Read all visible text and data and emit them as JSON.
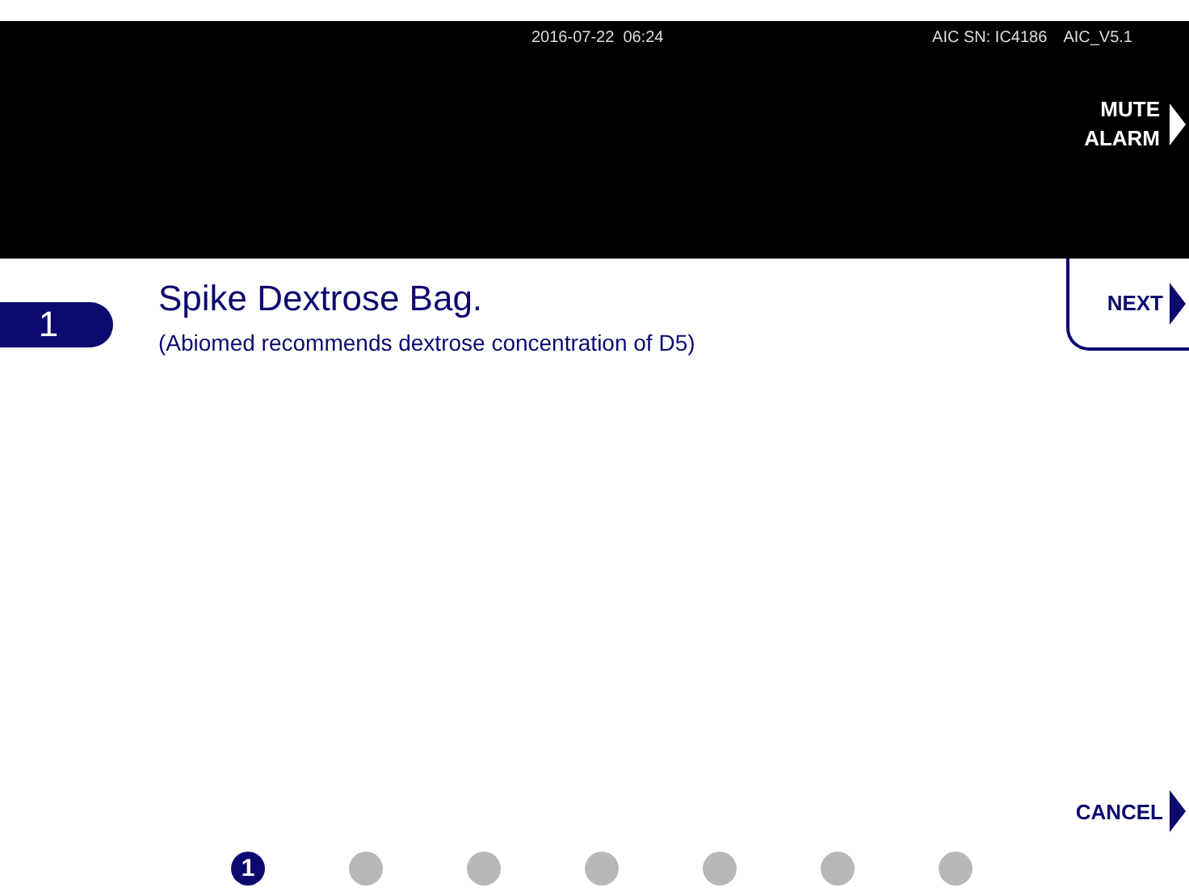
{
  "header": {
    "datetime": "2016-07-22  06:24",
    "serial": "AIC SN: IC4186",
    "version": "AIC_V5.1",
    "mute_button": {
      "lines": [
        "MUTE",
        "ALARM"
      ]
    }
  },
  "step": {
    "number": "1",
    "title": "Spike Dextrose Bag.",
    "note": "(Abiomed recommends dextrose concentration of D5)"
  },
  "next_button": {
    "label": "NEXT"
  },
  "cancel_button": {
    "label": "CANCEL"
  },
  "progress": [
    {
      "label": "1",
      "selected": true
    },
    {
      "selected": false
    },
    {
      "selected": false
    },
    {
      "selected": false
    },
    {
      "selected": false
    },
    {
      "selected": false
    },
    {
      "selected": false
    }
  ]
}
